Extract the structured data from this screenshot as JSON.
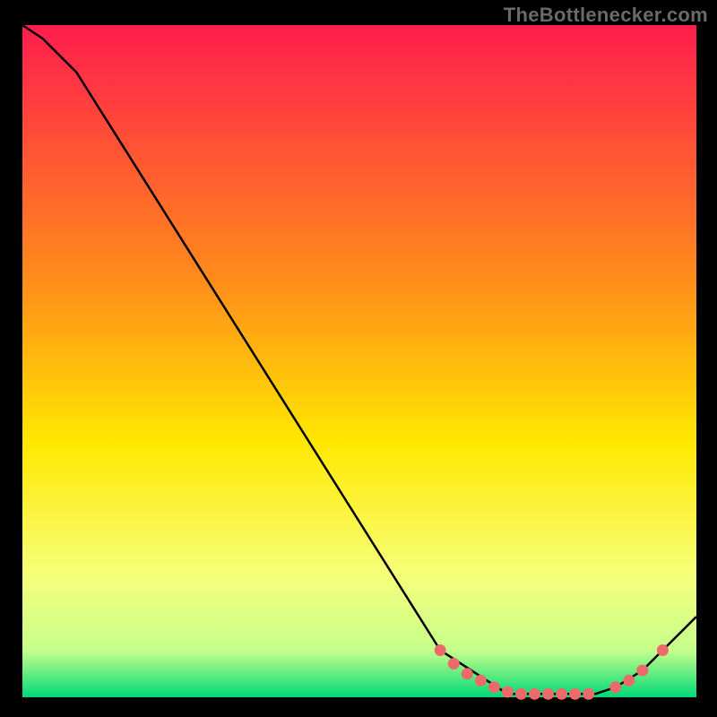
{
  "brand": "TheBottlenecker.com",
  "colors": {
    "top": "#ff1d4e",
    "mid1": "#ff8c1a",
    "mid2": "#ffe800",
    "low1": "#f6ff7a",
    "low2": "#c6ff8c",
    "bottom": "#00d977",
    "curve": "#000000",
    "marker": "#ed6a6a",
    "bg": "#000000"
  },
  "chart_data": {
    "type": "line",
    "title": "",
    "xlabel": "",
    "ylabel": "",
    "xlim": [
      0,
      100
    ],
    "ylim": [
      0,
      100
    ],
    "curve": {
      "x": [
        0,
        3,
        8,
        62,
        72,
        85,
        88,
        92,
        95,
        100
      ],
      "y": [
        100,
        98,
        93,
        7,
        0.5,
        0.5,
        1.5,
        4,
        7,
        12
      ]
    },
    "markers": {
      "x": [
        62,
        64,
        66,
        68,
        70,
        72,
        74,
        76,
        78,
        80,
        82,
        84,
        88,
        90,
        92,
        95
      ],
      "y": [
        7,
        5,
        3.5,
        2.5,
        1.5,
        0.8,
        0.5,
        0.5,
        0.5,
        0.5,
        0.5,
        0.5,
        1.5,
        2.5,
        4,
        7
      ]
    }
  }
}
